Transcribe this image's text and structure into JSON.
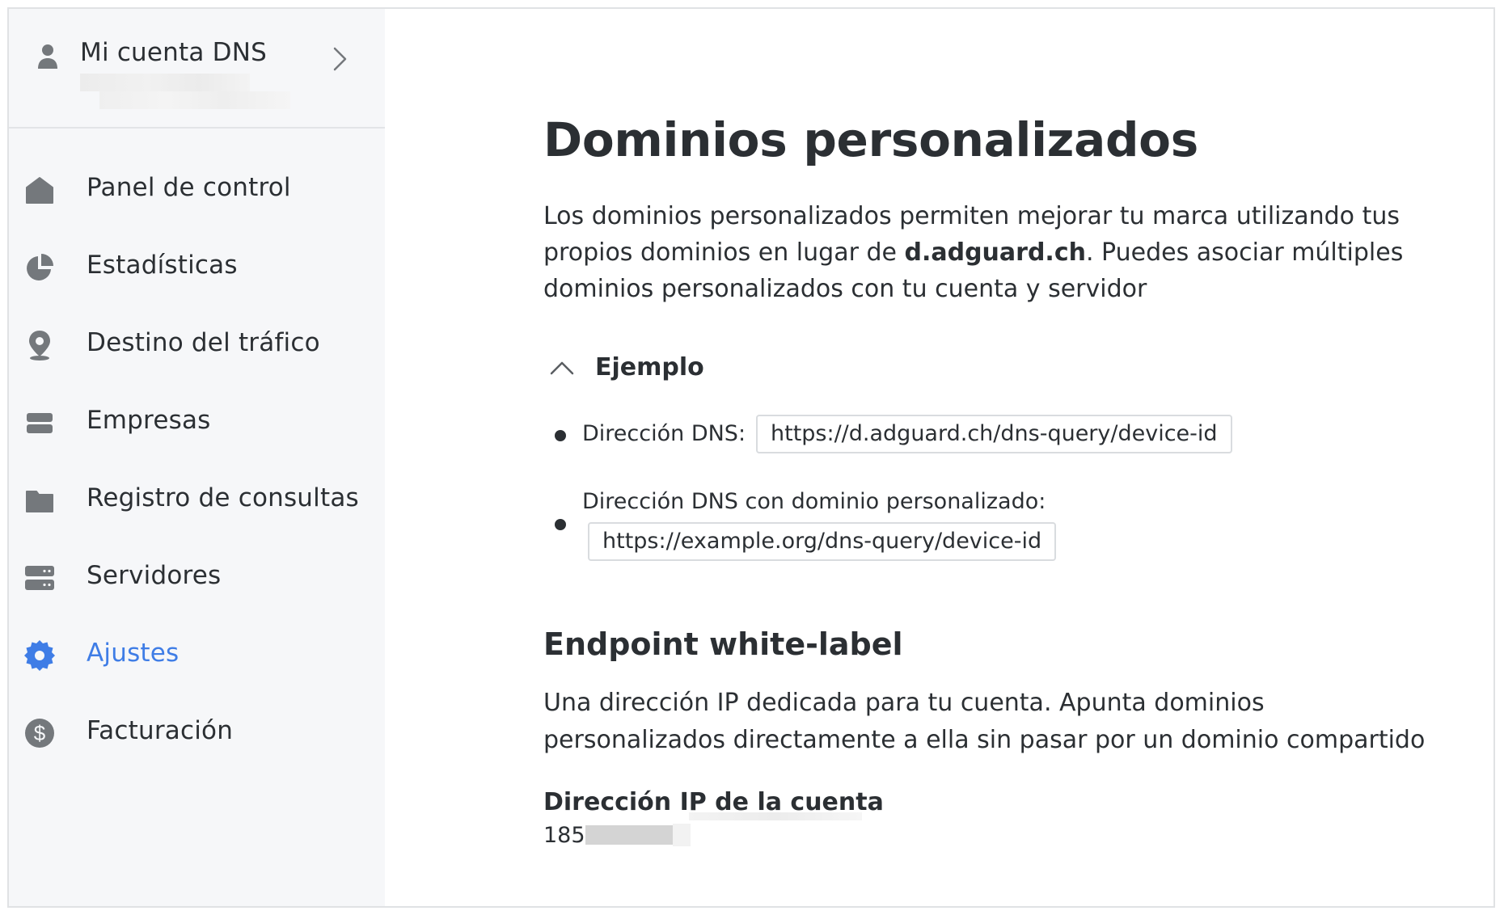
{
  "sidebar": {
    "account": {
      "title": "Mi cuenta DNS"
    },
    "items": [
      {
        "label": "Panel de control",
        "icon": "home-icon"
      },
      {
        "label": "Estadísticas",
        "icon": "pie-chart-icon"
      },
      {
        "label": "Destino del tráfico",
        "icon": "location-pin-icon"
      },
      {
        "label": "Empresas",
        "icon": "building-icon"
      },
      {
        "label": "Registro de consultas",
        "icon": "folder-icon"
      },
      {
        "label": "Servidores",
        "icon": "server-icon"
      },
      {
        "label": "Ajustes",
        "icon": "gear-icon",
        "active": true
      },
      {
        "label": "Facturación",
        "icon": "dollar-icon"
      }
    ]
  },
  "main": {
    "title": "Dominios personalizados",
    "description_part1": "Los dominios personalizados permiten mejorar tu marca utilizando tus propios dominios en lugar de ",
    "description_bold": "d.adguard.ch",
    "description_part2": ". Puedes asociar múltiples dominios personalizados con tu cuenta y servidor",
    "example": {
      "toggle_label": "Ejemplo",
      "dns_address_label": "Dirección DNS:",
      "dns_address_value": "https://d.adguard.ch/dns-query/device-id",
      "custom_domain_label": "Dirección DNS con dominio personalizado:",
      "custom_domain_value": "https://example.org/dns-query/device-id"
    },
    "endpoint": {
      "title": "Endpoint white-label",
      "description": "Una dirección IP dedicada para tu cuenta. Apunta dominios personalizados directamente a ella sin pasar por un dominio compartido",
      "ip_label": "Dirección IP de la cuenta",
      "ip_value_visible": "185."
    }
  },
  "colors": {
    "accent": "#3f7de6",
    "icon_gray": "#74787c",
    "text": "#2b2f33",
    "sidebar_bg": "#f6f7f9"
  }
}
